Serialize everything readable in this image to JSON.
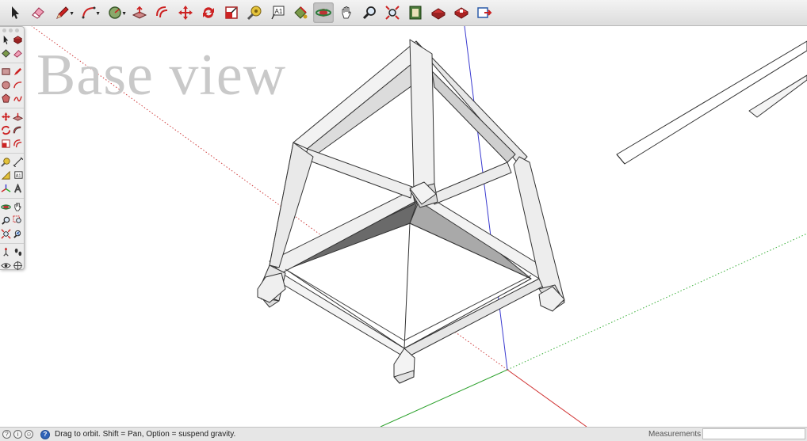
{
  "viewport": {
    "watermark": "Base view"
  },
  "toolbar": {
    "tools": [
      {
        "name": "select-tool",
        "icon": "arrow-icon"
      },
      {
        "name": "eraser-tool",
        "icon": "eraser-icon"
      },
      {
        "name": "line-tool",
        "icon": "pencil-icon",
        "dropdown": true
      },
      {
        "name": "arc-tool",
        "icon": "arc-icon",
        "dropdown": true
      },
      {
        "name": "shape-tool",
        "icon": "circle-icon",
        "dropdown": true
      },
      {
        "name": "push-pull-tool",
        "icon": "push-pull-icon"
      },
      {
        "name": "offset-tool",
        "icon": "offset-icon"
      },
      {
        "name": "move-tool",
        "icon": "move-icon"
      },
      {
        "name": "rotate-tool",
        "icon": "rotate-icon"
      },
      {
        "name": "scale-tool",
        "icon": "scale-icon"
      },
      {
        "name": "tape-measure-tool",
        "icon": "tape-measure-icon"
      },
      {
        "name": "text-tool",
        "icon": "text-icon",
        "label": "A1"
      },
      {
        "name": "paint-bucket-tool",
        "icon": "paint-bucket-icon"
      },
      {
        "name": "orbit-tool",
        "icon": "orbit-icon",
        "active": true
      },
      {
        "name": "pan-tool",
        "icon": "hand-icon"
      },
      {
        "name": "zoom-tool",
        "icon": "magnifier-icon"
      },
      {
        "name": "zoom-extents-tool",
        "icon": "zoom-extents-icon"
      },
      {
        "name": "warehouse-tool",
        "icon": "warehouse-icon"
      },
      {
        "name": "share-model-tool",
        "icon": "share-model-icon"
      },
      {
        "name": "extension-warehouse-tool",
        "icon": "extension-warehouse-icon"
      },
      {
        "name": "send-to-layout-tool",
        "icon": "layout-icon"
      }
    ]
  },
  "palette": {
    "text_tool_label": "A1"
  },
  "statusbar": {
    "text": "Drag to orbit. Shift = Pan, Option = suspend gravity.",
    "measurements_label": "Measurements",
    "measurements_value": ""
  }
}
